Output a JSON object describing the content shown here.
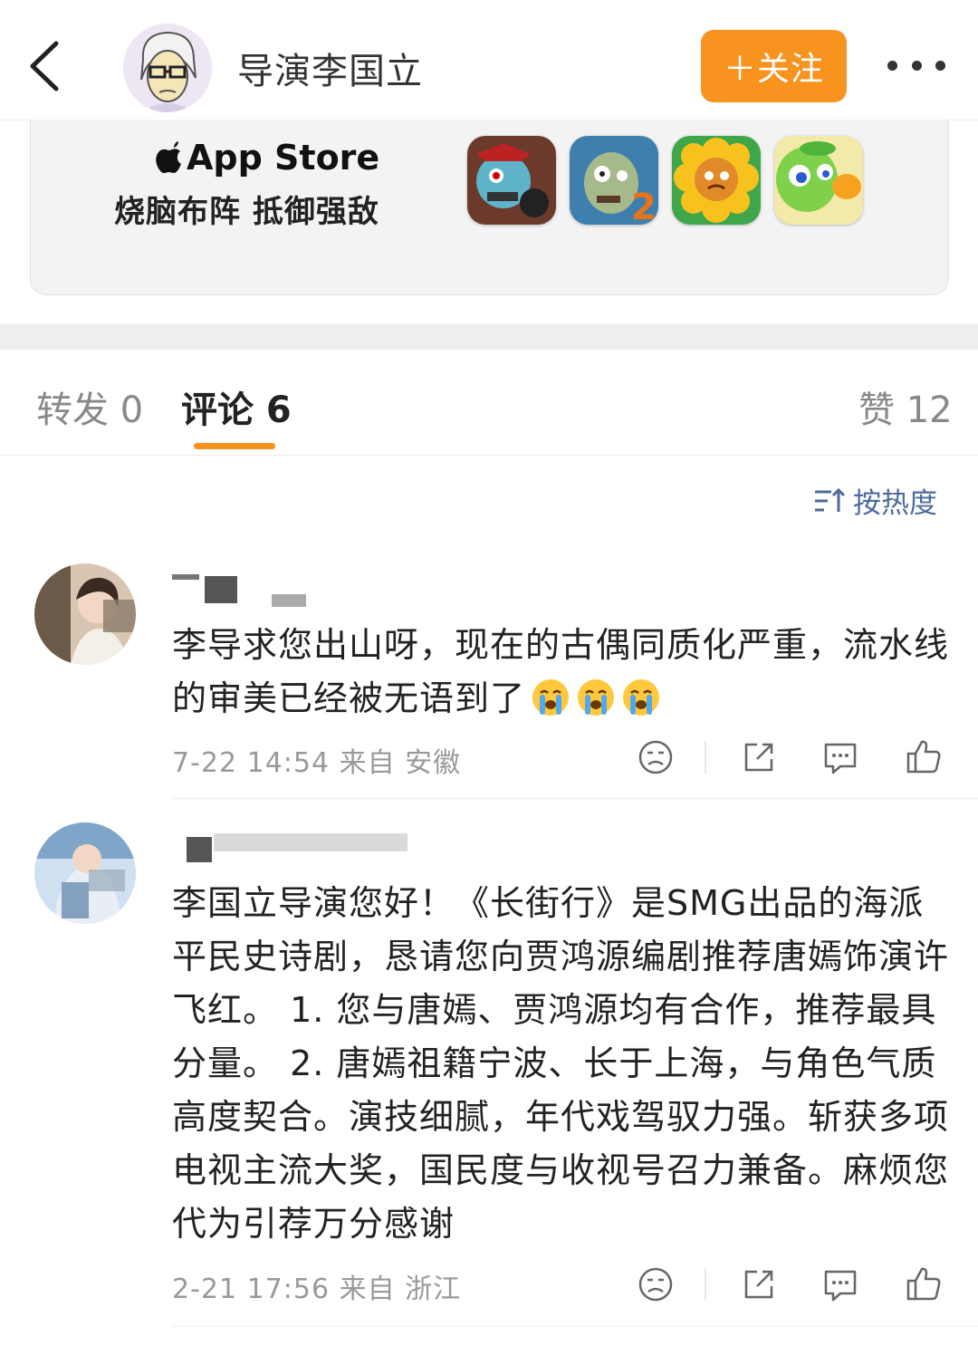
{
  "header": {
    "author_name": "导演李国立",
    "follow_label": "＋关注"
  },
  "ad": {
    "store_label": "App Store",
    "tagline": "烧脑布阵 抵御强敌"
  },
  "tabs": [
    {
      "label": "转发 0"
    },
    {
      "label": "评论 6"
    },
    {
      "label": "赞 12"
    }
  ],
  "sort_label": "按热度",
  "comments": [
    {
      "name": "",
      "text": "李导求您出山呀，现在的古偶同质化严重，流水线的审美已经被无语到了",
      "emoji_count": 3,
      "meta": "7-22 14:54  来自 安徽"
    },
    {
      "name": "",
      "text": "李国立导演您好！《长街行》是SMG出品的海派平民史诗剧，恳请您向贾鸿源编剧推荐唐嫣饰演许飞红。 1. 您与唐嫣、贾鸿源均有合作，推荐最具分量。 2. 唐嫣祖籍宁波、长于上海，与角色气质高度契合。演技细腻，年代戏驾驭力强。斩获多项电视主流大奖，国民度与收视号召力兼备。麻烦您代为引荐万分感谢",
      "meta": "2-21 17:56  来自 浙江"
    }
  ],
  "colors": {
    "accent": "#f7931e",
    "sort_blue": "#4c6b9a"
  }
}
